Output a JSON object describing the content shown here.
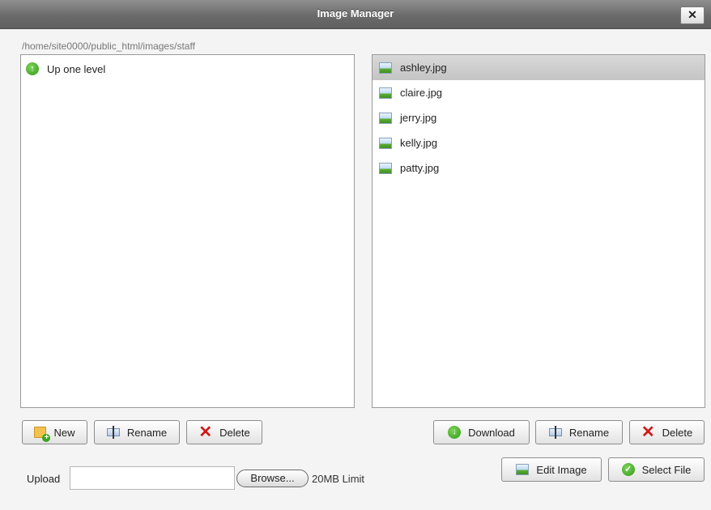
{
  "window": {
    "title": "Image Manager",
    "close_label": "✕"
  },
  "path": "/home/site0000/public_html/images/staff",
  "folders": {
    "up_label": "Up one level"
  },
  "files": [
    {
      "name": "ashley.jpg",
      "selected": true
    },
    {
      "name": "claire.jpg",
      "selected": false
    },
    {
      "name": "jerry.jpg",
      "selected": false
    },
    {
      "name": "kelly.jpg",
      "selected": false
    },
    {
      "name": "patty.jpg",
      "selected": false
    }
  ],
  "folder_actions": {
    "new": "New",
    "rename": "Rename",
    "delete": "Delete"
  },
  "file_actions": {
    "download": "Download",
    "rename": "Rename",
    "delete": "Delete",
    "edit_image": "Edit Image",
    "select_file": "Select File"
  },
  "upload": {
    "label": "Upload",
    "value": "",
    "browse": "Browse...",
    "limit": "20MB Limit"
  },
  "icons": {
    "up": "arrow-up-circle-icon",
    "file": "image-file-icon",
    "new": "new-folder-icon",
    "rename": "rename-icon",
    "delete": "delete-x-icon",
    "download": "download-icon",
    "edit": "edit-image-icon",
    "select": "checkmark-icon",
    "close": "close-icon"
  },
  "colors": {
    "title_bar": "#6b6b6b",
    "selected_row": "#c8c8c8",
    "delete_red": "#d01818",
    "accent_green": "#2e9a16"
  }
}
